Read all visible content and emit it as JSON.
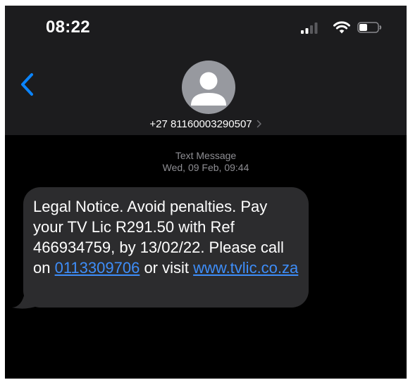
{
  "status_bar": {
    "time": "08:22",
    "icons": [
      "cellular-signal-icon",
      "wifi-icon",
      "battery-icon"
    ]
  },
  "header": {
    "back_icon": "chevron-left-icon",
    "avatar_icon": "person-silhouette-icon",
    "contact_number": "+27 81160003290507",
    "contact_chevron_icon": "chevron-right-icon"
  },
  "conversation": {
    "meta_type": "Text Message",
    "meta_timestamp": "Wed, 09 Feb, 09:44",
    "message": {
      "text_before_phone": "Legal Notice. Avoid penalties. Pay your TV Lic R291.50 with Ref 466934759, by 13/02/22. Please call on ",
      "phone_link": "0113309706",
      "text_between": " or visit ",
      "url_link": "www.tvlic.co.za"
    }
  },
  "colors": {
    "header_bg": "#1c1c1e",
    "chat_bg": "#000000",
    "bubble_bg": "#2c2c2e",
    "link": "#3e8efa",
    "accent_blue": "#0a84ff",
    "meta_text": "#8e8e93"
  }
}
